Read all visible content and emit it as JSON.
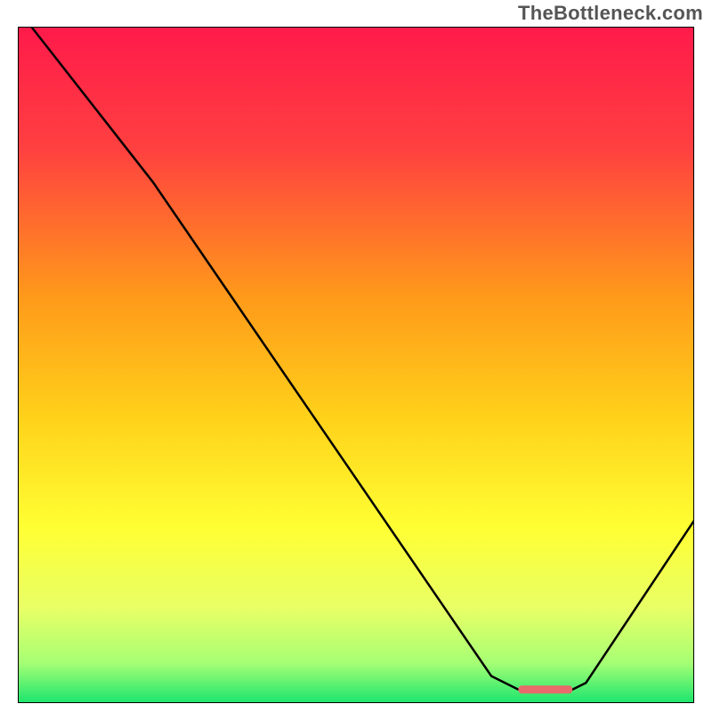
{
  "watermark": "TheBottleneck.com",
  "chart_data": {
    "type": "line",
    "title": "",
    "xlabel": "",
    "ylabel": "",
    "xlim": [
      0,
      100
    ],
    "ylim": [
      0,
      100
    ],
    "gradient_stops": [
      {
        "offset": 0,
        "color": "#ff1a4b"
      },
      {
        "offset": 18,
        "color": "#ff4040"
      },
      {
        "offset": 40,
        "color": "#ff9a1a"
      },
      {
        "offset": 58,
        "color": "#ffd21a"
      },
      {
        "offset": 74,
        "color": "#ffff33"
      },
      {
        "offset": 86,
        "color": "#e8ff66"
      },
      {
        "offset": 94,
        "color": "#a7ff74"
      },
      {
        "offset": 100,
        "color": "#1be56e"
      }
    ],
    "series": [
      {
        "name": "bottleneck-curve",
        "x": [
          2,
          20,
          70,
          74,
          82,
          84,
          100
        ],
        "y": [
          100,
          77,
          4,
          2,
          2,
          3,
          27
        ]
      }
    ],
    "marker": {
      "name": "optimal-range",
      "x_start": 74,
      "x_end": 82,
      "y": 2,
      "color": "#e86a6a"
    }
  }
}
